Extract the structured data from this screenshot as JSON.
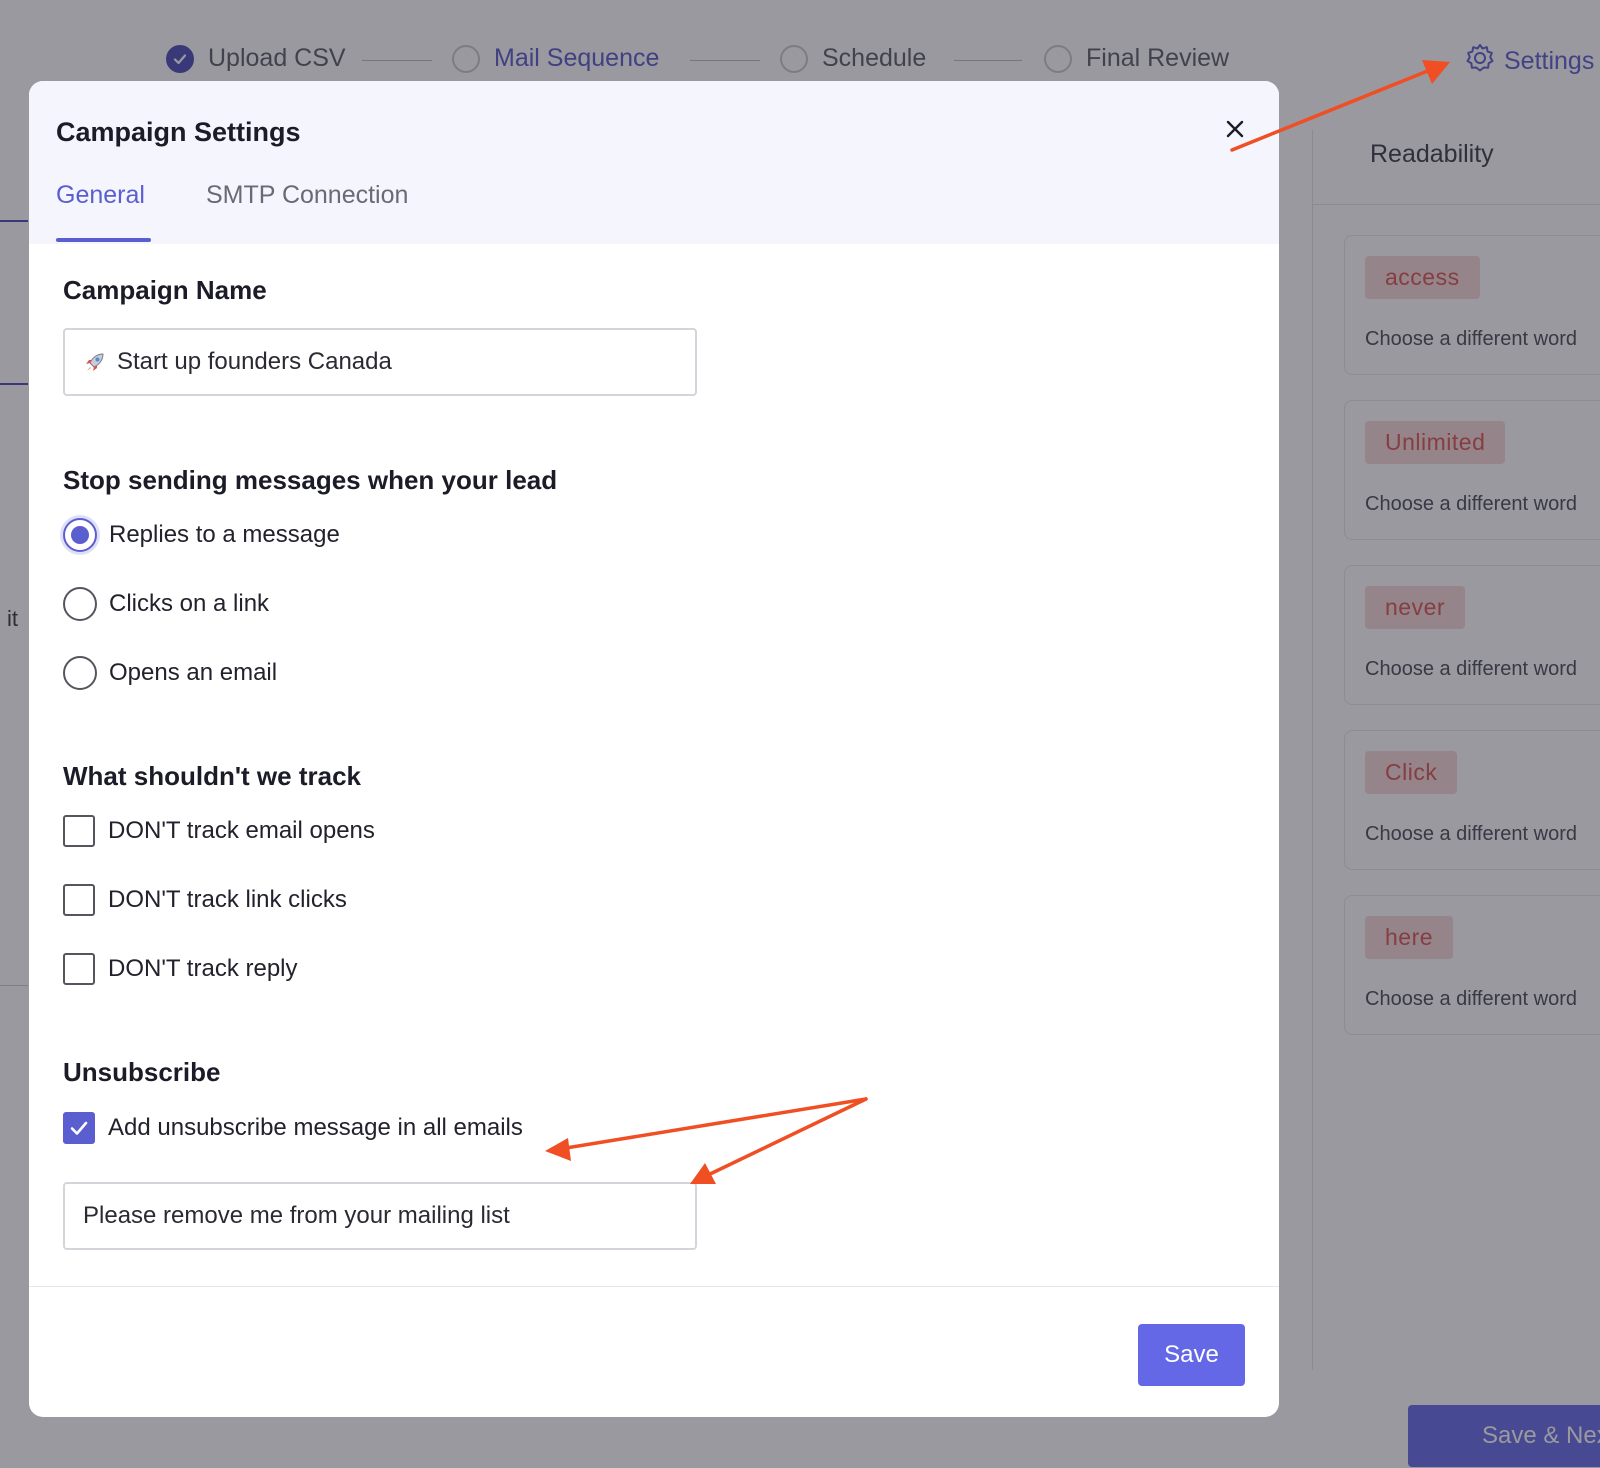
{
  "stepper": {
    "steps": [
      {
        "label": "Upload CSV",
        "state": "done"
      },
      {
        "label": "Mail Sequence",
        "state": "active"
      },
      {
        "label": "Schedule",
        "state": "pending"
      },
      {
        "label": "Final Review",
        "state": "pending"
      }
    ],
    "settings_label": "Settings"
  },
  "readability": {
    "title": "Readability",
    "suggestions": [
      {
        "word": "access",
        "hint": "Choose a different word"
      },
      {
        "word": "Unlimited",
        "hint": "Choose a different word"
      },
      {
        "word": "never",
        "hint": "Choose a different word"
      },
      {
        "word": "Click",
        "hint": "Choose a different word"
      },
      {
        "word": "here",
        "hint": "Choose a different word"
      }
    ]
  },
  "background_fragments": {
    "left_text": "it"
  },
  "save_next_label": "Save & Next",
  "modal": {
    "title": "Campaign Settings",
    "tabs": [
      {
        "label": "General",
        "active": true
      },
      {
        "label": "SMTP Connection",
        "active": false
      }
    ],
    "campaign_name": {
      "label": "Campaign Name",
      "value": "Start up founders Canada",
      "emoji_icon": "rocket-icon"
    },
    "stop_sending": {
      "label": "Stop sending messages when your lead",
      "options": [
        {
          "label": "Replies to a message",
          "checked": true
        },
        {
          "label": "Clicks on a link",
          "checked": false
        },
        {
          "label": "Opens an email",
          "checked": false
        }
      ]
    },
    "tracking": {
      "label": "What shouldn't we track",
      "options": [
        {
          "label": "DON'T track email opens",
          "checked": false
        },
        {
          "label": "DON'T track link clicks",
          "checked": false
        },
        {
          "label": "DON'T track reply",
          "checked": false
        }
      ]
    },
    "unsubscribe": {
      "label": "Unsubscribe",
      "checkbox_label": "Add unsubscribe message in all emails",
      "checked": true,
      "message_value": "Please remove me from your mailing list"
    },
    "save_label": "Save"
  },
  "colors": {
    "accent": "#5b5ecf",
    "button": "#6468e6",
    "annotation_arrow": "#f04e23",
    "suggestion_text": "#d9534f",
    "suggestion_bg": "#f7d7d7"
  }
}
